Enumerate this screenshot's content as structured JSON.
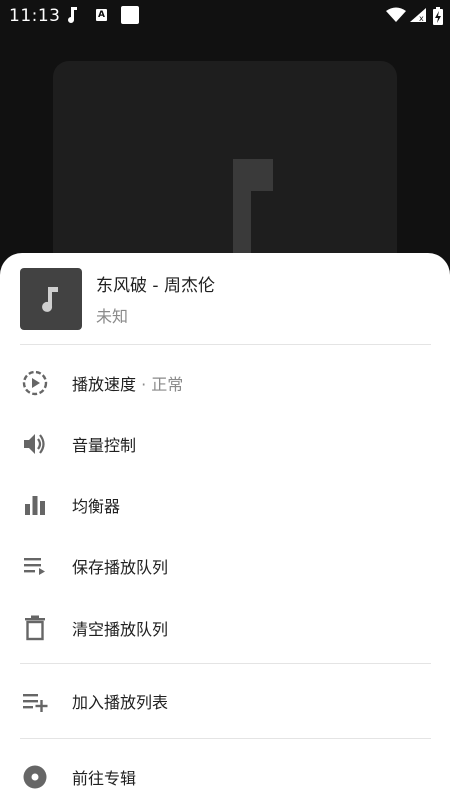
{
  "status_bar": {
    "time": "11:13",
    "a_badge": "A",
    "icons": [
      "music-note-icon",
      "a-badge-icon",
      "square-icon",
      "wifi-icon",
      "signal-icon",
      "battery-charging-icon"
    ]
  },
  "now_playing": {
    "title": "东风破 - 周杰伦",
    "artist": "未知"
  },
  "menu": {
    "speed": {
      "label": "播放速度",
      "separator": " · ",
      "value": "正常",
      "icon": "playback-speed-icon"
    },
    "volume": {
      "label": "音量控制",
      "icon": "volume-icon"
    },
    "equalizer": {
      "label": "均衡器",
      "icon": "equalizer-icon"
    },
    "save_queue": {
      "label": "保存播放队列",
      "icon": "save-queue-icon"
    },
    "clear_queue": {
      "label": "清空播放队列",
      "icon": "trash-icon"
    },
    "add_playlist": {
      "label": "加入播放列表",
      "icon": "playlist-add-icon"
    },
    "go_album": {
      "label": "前往专辑",
      "icon": "album-icon"
    }
  },
  "colors": {
    "background": "#111111",
    "sheet": "#ffffff",
    "icon": "#666666",
    "text": "#202020",
    "secondary_text": "#8a8a8a"
  }
}
